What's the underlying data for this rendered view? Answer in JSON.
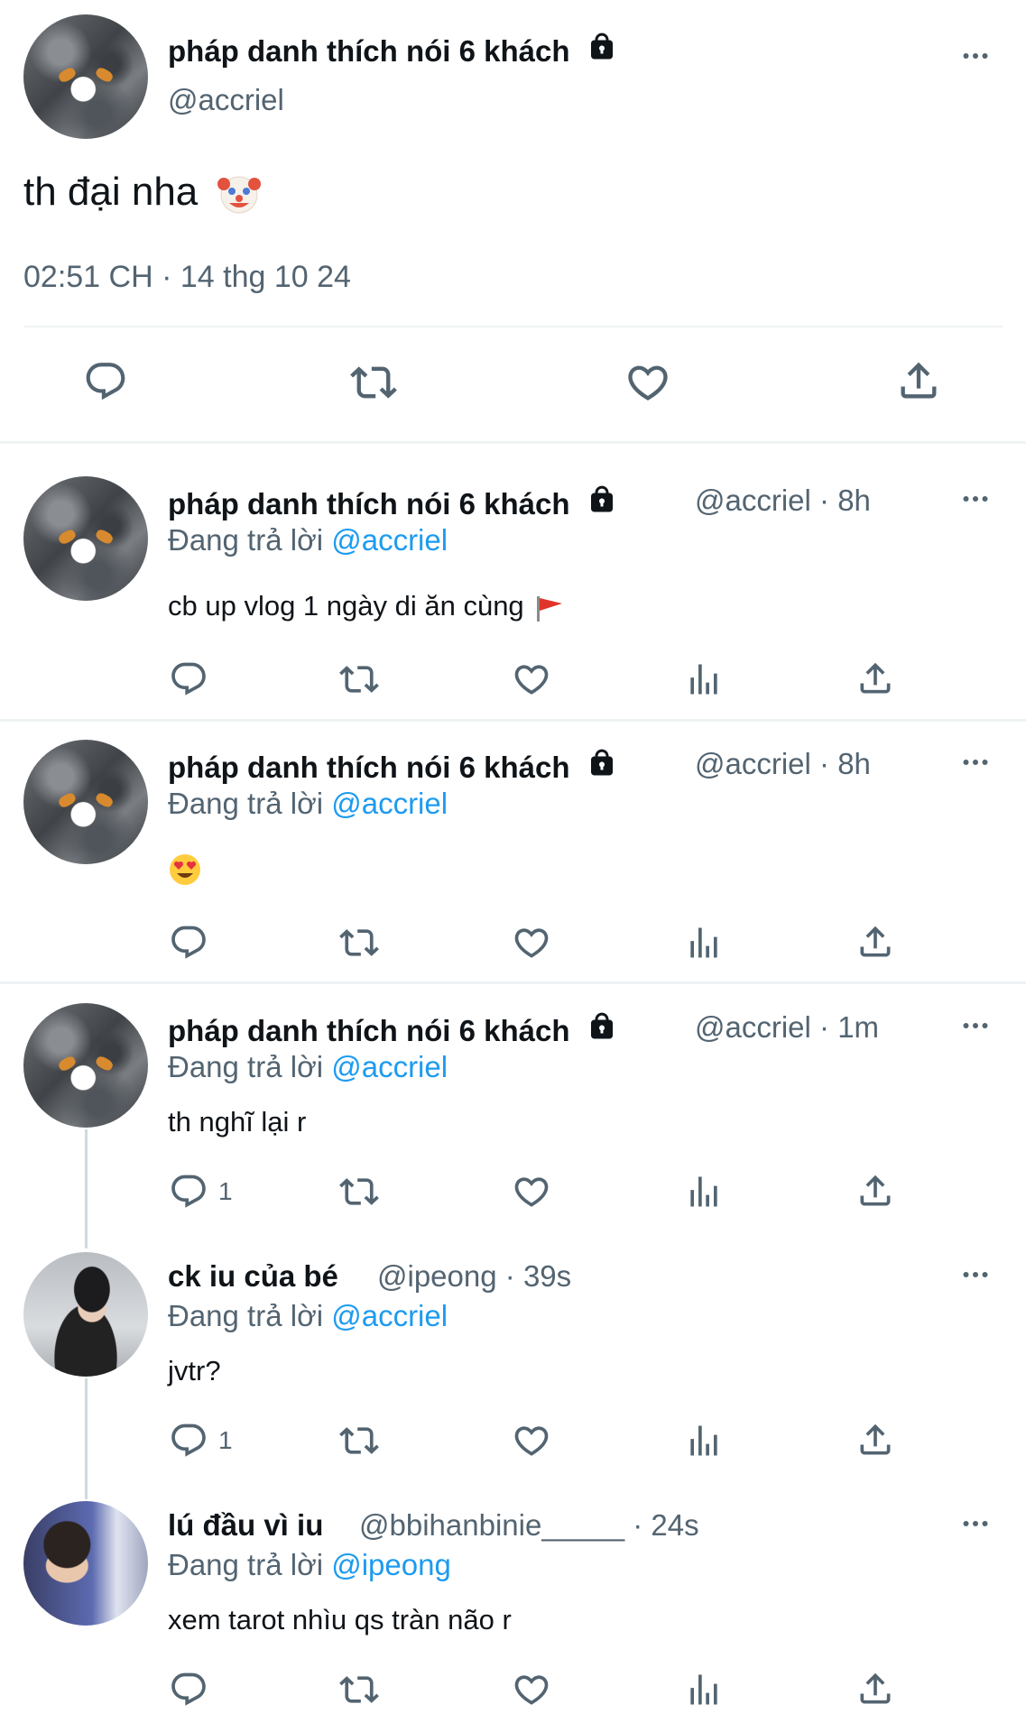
{
  "main_tweet": {
    "display_name": "pháp danh thích nói 6 khách",
    "handle": "@accriel",
    "text": "th đại nha",
    "emoji": "clown-face-emoji",
    "timestamp": "02:51 CH · 14 thg 10 24"
  },
  "replying_prefix": "Đang trả lời",
  "replies": [
    {
      "display_name": "pháp danh thích nói 6 khách",
      "handle": "@accriel",
      "time": "· 8h",
      "reply_to": "@accriel",
      "text": "cb up vlog 1 ngày di ăn cùng",
      "emoji": "red-flag-emoji",
      "reply_count": ""
    },
    {
      "display_name": "pháp danh thích nói 6 khách",
      "handle": "@accriel",
      "time": "· 8h",
      "reply_to": "@accriel",
      "text": "",
      "emoji": "heart-eyes-emoji",
      "reply_count": ""
    },
    {
      "display_name": "pháp danh thích nói 6 khách",
      "handle": "@accriel",
      "time": "· 1m",
      "reply_to": "@accriel",
      "text": "th nghĩ lại r",
      "reply_count": "1"
    },
    {
      "display_name": "ck iu của bé",
      "handle": "@ipeong",
      "time": "· 39s",
      "reply_to": "@accriel",
      "text": "jvtr?",
      "reply_count": "1"
    },
    {
      "display_name": "lú đầu vì iu",
      "handle": "@bbihanbinie_____",
      "time": "· 24s",
      "reply_to": "@ipeong",
      "text": "xem tarot nhìu qs tràn não r",
      "reply_count": ""
    }
  ],
  "colors": {
    "text": "#0f1419",
    "secondary": "#536471",
    "accent": "#1d9bf0",
    "divider": "#eff3f4"
  }
}
